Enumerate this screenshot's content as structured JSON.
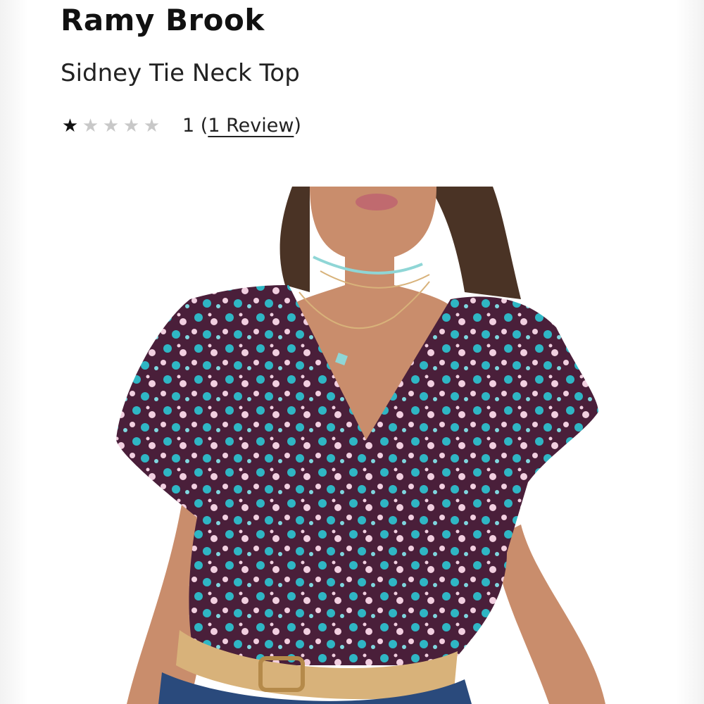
{
  "product": {
    "brand": "Ramy Brook",
    "name": "Sidney Tie Neck Top"
  },
  "rating": {
    "stars_filled": 1,
    "stars_total": 5,
    "value": "1",
    "review_link_label": "1 Review"
  },
  "image": {
    "description_icon": "product-photo",
    "colors": {
      "fabric_base": "#4a1f3a",
      "print_teal": "#2fb6c4",
      "print_pink": "#f2cfe0",
      "skin": "#c98d6c",
      "hair": "#4a3325",
      "denim": "#2a4a7c",
      "belt": "#d8b27a"
    }
  }
}
